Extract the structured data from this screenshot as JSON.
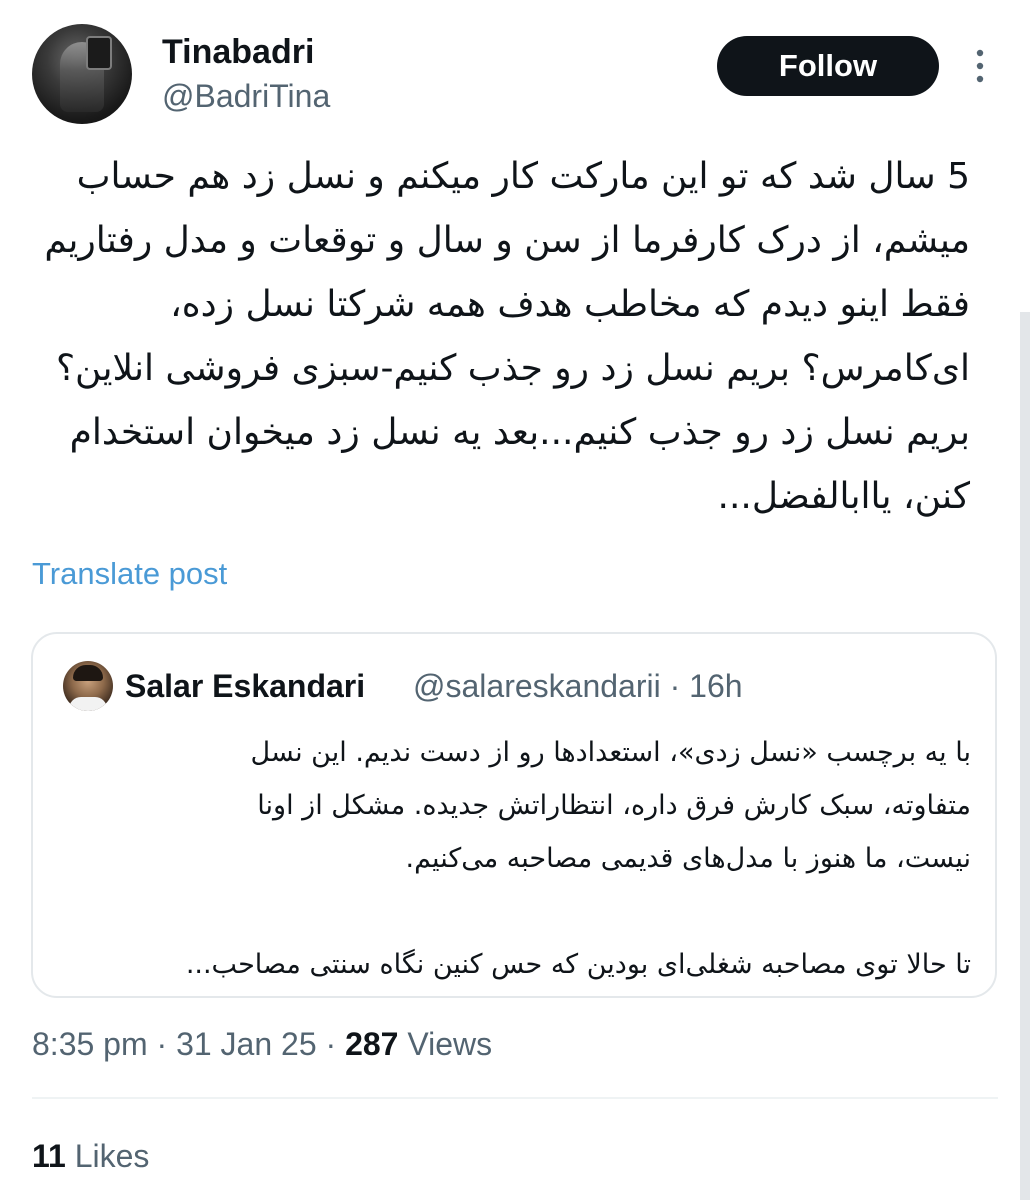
{
  "author": {
    "name": "Tinabadri",
    "handle": "@BadriTina"
  },
  "actions": {
    "follow_label": "Follow",
    "more_icon": "more-vertical-icon"
  },
  "post": {
    "text": "5 سال شد که تو این مارکت کار میکنم و نسل زد هم حساب\nمیشم، از درک کارفرما از سن و سال و توقعات و مدل رفتاریم\nفقط اینو دیدم که مخاطب هدف همه شرکتا نسل زده،\nای‌کامرس؟ بریم نسل زد رو جذب کنیم-سبزی فروشی انلاین؟\nبریم نسل زد رو جذب کنیم...بعد یه نسل زد میخوان استخدام\nکنن، یاابالفضل...",
    "translate_label": "Translate post"
  },
  "quote": {
    "author_name": "Salar Eskandari",
    "author_handle": "@salareskandarii",
    "separator": "·",
    "age": "16h",
    "text": "با یه برچسب «نسل زدی»، استعدادها رو از دست ندیم. این نسل\nمتفاوته، سبک کارش فرق داره، انتظاراتش جدیده. مشکل از اونا\nنیست، ما هنوز با مدل‌های قدیمی مصاحبه می‌کنیم.\n\nتا حالا توی مصاحبه شغلی‌ای بودین که حس کنین نگاه سنتی مصاحب..."
  },
  "meta": {
    "time": "8:35 pm",
    "date": "31 Jan 25",
    "separator": "·",
    "views_count": "287",
    "views_label": "Views"
  },
  "stats": {
    "likes_count": "11",
    "likes_label": "Likes"
  },
  "colors": {
    "link": "#4a9ad6",
    "muted": "#536471",
    "text": "#0f1419",
    "button_bg": "#0f1419",
    "border": "#e4e8eb"
  }
}
